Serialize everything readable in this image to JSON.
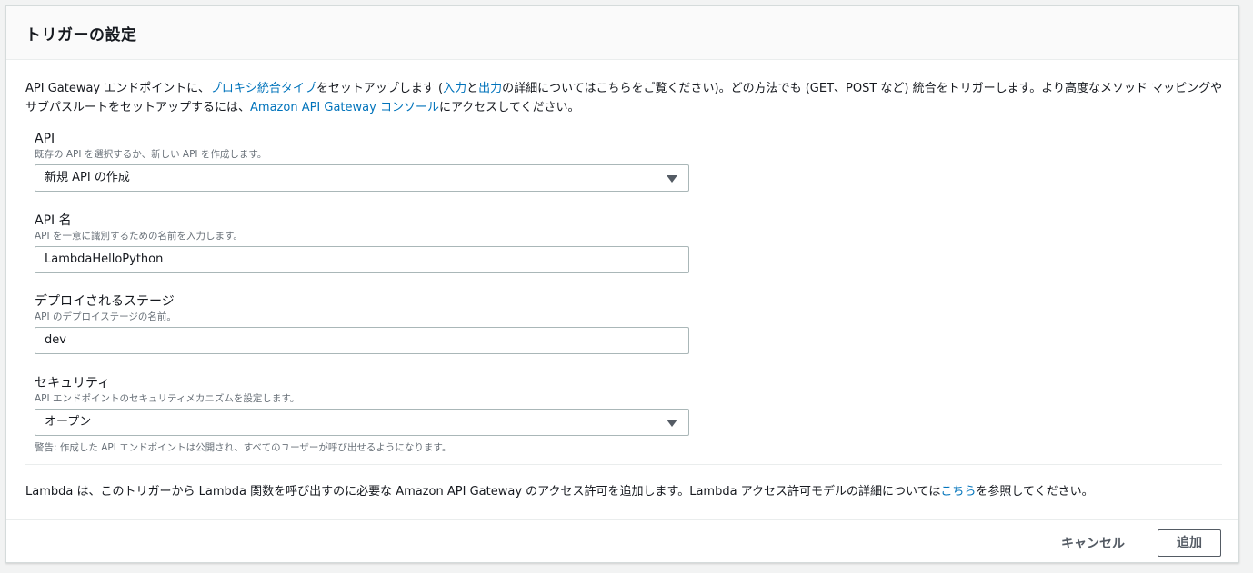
{
  "panel": {
    "title": "トリガーの設定"
  },
  "intro": {
    "t1": "API Gateway エンドポイントに、",
    "link_proxy": "プロキシ統合タイプ",
    "t2": "をセットアップします (",
    "link_input": "入力",
    "t3": "と",
    "link_output": "出力",
    "t4": "の詳細についてはこちらをご覧ください)。どの方法でも (GET、POST など) 統合をトリガーします。より高度なメソッド マッピングやサブパスルートをセットアップするには、",
    "link_console": "Amazon API Gateway コンソール",
    "t5": "にアクセスしてください。"
  },
  "fields": {
    "api": {
      "label": "API",
      "description": "既存の API を選択するか、新しい API を作成します。",
      "value": "新規 API の作成"
    },
    "api_name": {
      "label": "API 名",
      "description": "API を一意に識別するための名前を入力します。",
      "value": "LambdaHelloPython"
    },
    "stage": {
      "label": "デプロイされるステージ",
      "description": "API のデプロイステージの名前。",
      "value": "dev"
    },
    "security": {
      "label": "セキュリティ",
      "description": "API エンドポイントのセキュリティメカニズムを設定します。",
      "value": "オープン",
      "warning": "警告: 作成した API エンドポイントは公開され、すべてのユーザーが呼び出せるようになります。"
    }
  },
  "permission": {
    "t1": "Lambda は、このトリガーから Lambda 関数を呼び出すのに必要な Amazon API Gateway のアクセス許可を追加します。Lambda アクセス許可モデルの詳細については",
    "link": "こちら",
    "t2": "を参照してください。"
  },
  "footer": {
    "cancel_label": "キャンセル",
    "add_label": "追加"
  },
  "colors": {
    "link": "#0073bb",
    "text": "#16191f",
    "muted": "#687078",
    "border": "#aab7b8"
  },
  "icons": {
    "dropdown": "chevron-down-icon"
  }
}
